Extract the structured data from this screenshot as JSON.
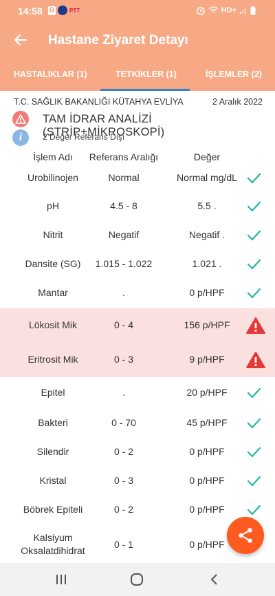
{
  "status_bar": {
    "time": "14:58",
    "b_badge": "B",
    "ptt": "PTT",
    "network": "HD+"
  },
  "app_bar": {
    "title": "Hastane Ziyaret Detayı"
  },
  "tabs": [
    {
      "label": "HASTALIKLAR (1)",
      "selected": false
    },
    {
      "label": "TETKİKLER (1)",
      "selected": true
    },
    {
      "label": "İŞLEMLER (2)",
      "selected": false
    }
  ],
  "visit": {
    "hospital": "T.C. SAĞLIK BAKANLIĞI KÜTAHYA EVLİYA",
    "date": "2 Aralık 2022",
    "test_name": "TAM İDRAR ANALİZİ (STRİP+MİKROSKOPİ)",
    "ref_note": "2 Değer Referans Dışı"
  },
  "table": {
    "headers": [
      "İşlem Adı",
      "Referans Aralığı",
      "Değer"
    ],
    "rows": [
      {
        "name": "Urobilinojen",
        "ref": "Normal",
        "value": "Normal mg/dL",
        "status": "ok"
      },
      {
        "name": "pH",
        "ref": "4.5 - 8",
        "value": "5.5 .",
        "status": "ok"
      },
      {
        "name": "Nitrit",
        "ref": "Negatif",
        "value": "Negatif .",
        "status": "ok"
      },
      {
        "name": "Dansite (SG)",
        "ref": "1.015 - 1.022",
        "value": "1.021 .",
        "status": "ok"
      },
      {
        "name": "Mantar",
        "ref": ".",
        "value": "0 p/HPF",
        "status": "ok"
      },
      {
        "name": "Lökosit Mik",
        "ref": "0 - 4",
        "value": "156 p/HPF",
        "status": "alert"
      },
      {
        "name": "Eritrosit Mik",
        "ref": "0 - 3",
        "value": "9 p/HPF",
        "status": "alert"
      },
      {
        "name": "Epitel",
        "ref": ".",
        "value": "20 p/HPF",
        "status": "ok"
      },
      {
        "name": "Bakteri",
        "ref": "0 - 70",
        "value": "45 p/HPF",
        "status": "ok"
      },
      {
        "name": "Silendir",
        "ref": "0 - 2",
        "value": "0 p/HPF",
        "status": "ok"
      },
      {
        "name": "Kristal",
        "ref": "0 - 3",
        "value": "0 p/HPF",
        "status": "ok"
      },
      {
        "name": "Böbrek Epiteli",
        "ref": "0 - 2",
        "value": "0 p/HPF",
        "status": "ok"
      },
      {
        "name": "Kalsiyum\nOksalatdihidrat",
        "ref": "0 - 1",
        "value": "0 p/HPF",
        "status": "ok"
      }
    ]
  },
  "colors": {
    "accent": "#f7a985",
    "ok": "#22b8a0",
    "alert": "#e53935",
    "alert_bg": "#fbe0e0",
    "fab": "#ff5a1f"
  }
}
